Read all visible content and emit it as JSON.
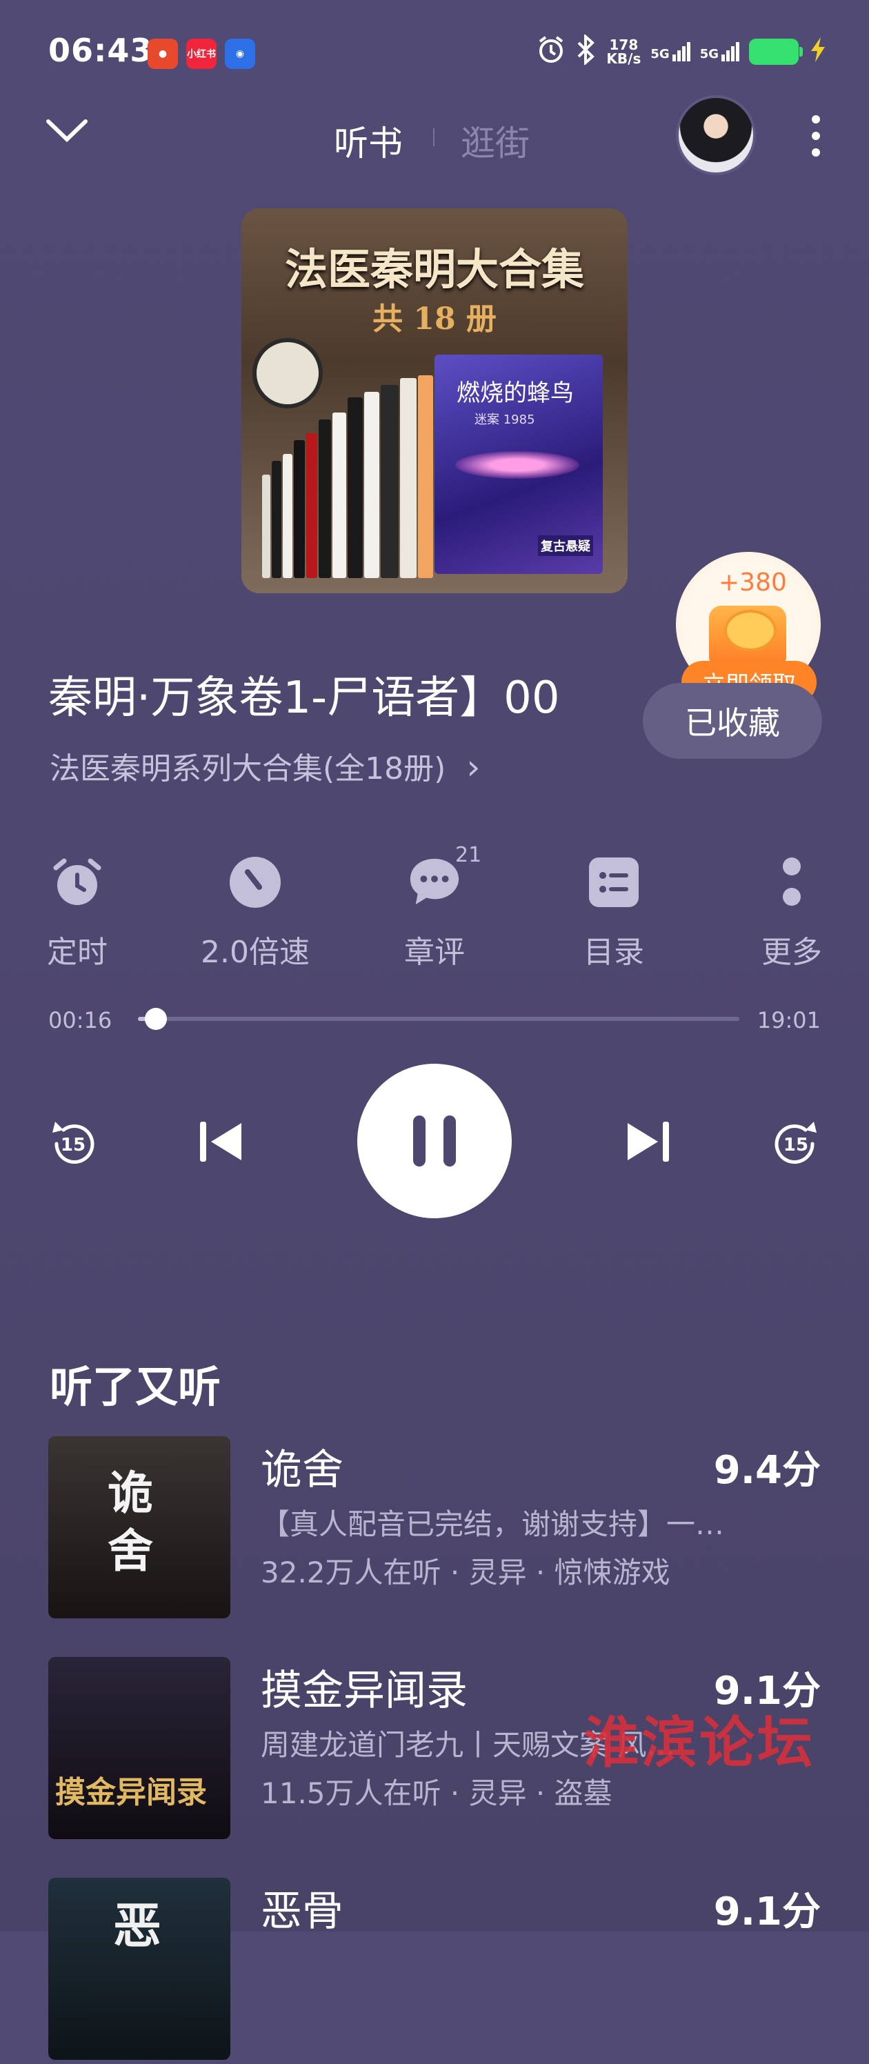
{
  "status_bar": {
    "time": "06:43",
    "app_badges": [
      {
        "label": "",
        "color": "#e8492c"
      },
      {
        "label": "小红书",
        "color": "#f0253c"
      },
      {
        "label": "",
        "color": "#2d6fe6"
      }
    ],
    "net_speed": "178\nKB/s",
    "signal_1": "5G",
    "signal_2": "5G"
  },
  "header": {
    "tab_active": "听书",
    "tab_inactive": "逛街"
  },
  "cover": {
    "title": "法医秦明大合集",
    "subtitle": "共 18 册",
    "main_book_title": "燃烧的蜂鸟",
    "main_book_series": "迷案 1985",
    "main_book_author": "复古悬疑"
  },
  "reward": {
    "amount": "+380",
    "button": "立即领取"
  },
  "track": {
    "title": "秦明·万象卷1-尸语者】00",
    "collect_label": "已收藏",
    "album": "法医秦明系列大合集(全18册)",
    "album_chevron": "›"
  },
  "controls": [
    {
      "label": "定时",
      "icon": "alarm-clock-icon"
    },
    {
      "label": "2.0倍速",
      "icon": "speed-gauge-icon"
    },
    {
      "label": "章评",
      "icon": "comment-bubble-icon"
    },
    {
      "label": "目录",
      "icon": "catalog-list-icon"
    },
    {
      "label": "更多",
      "icon": "more-dots-icon"
    }
  ],
  "comment_count": "21",
  "progress": {
    "current": "00:16",
    "total": "19:01",
    "fraction": 0.014
  },
  "playback": {
    "rewind_seconds": "15",
    "forward_seconds": "15"
  },
  "recommendations": {
    "title": "听了又听",
    "items": [
      {
        "name": "诡舍",
        "score": "9.4分",
        "desc": "【真人配音已完结，谢谢支持】一…",
        "meta": "32.2万人在听 · 灵异 · 惊悚游戏",
        "cover_text": "诡舍",
        "cover_colors": [
          "#3a3433",
          "#181414"
        ]
      },
      {
        "name": "摸金异闻录",
        "score": "9.1分",
        "desc": "周建龙道门老九丨天赐文案 风…",
        "meta": "11.5万人在听 · 灵异 · 盗墓",
        "cover_text": "摸金异闻录",
        "cover_colors": [
          "#2a2438",
          "#100c12"
        ]
      },
      {
        "name": "恶骨",
        "score": "9.1分",
        "desc": "",
        "meta": "",
        "cover_text": "恶",
        "cover_colors": [
          "#20303c",
          "#0e1418"
        ]
      }
    ]
  },
  "watermark": "淮滨论坛"
}
